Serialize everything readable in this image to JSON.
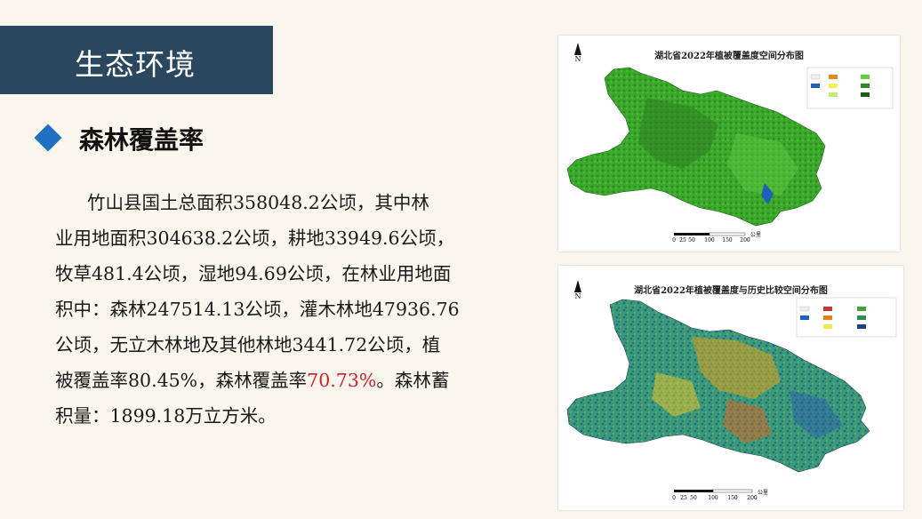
{
  "header": {
    "title": "生态环境"
  },
  "section": {
    "title": "森林覆盖率"
  },
  "paragraph": {
    "line1": "竹山县国土总面积358048.2公顷，其中林",
    "line2": "业用地面积304638.2公顷，耕地33949.6公顷，",
    "line3": "牧草481.4公顷，湿地94.69公顷，在林业用地面",
    "line4": "积中：森林247514.13公顷，灌木林地47936.76",
    "line5": "公顷，无立木林地及其他林地3441.72公顷，植",
    "line6_before": "被覆盖率80.45%，森林覆盖率",
    "line6_highlight": "70.73%",
    "line6_after": "。森林蓄",
    "line7": "积量：1899.18万立方米。"
  },
  "maps": [
    {
      "title": "湖北省2022年植被覆盖度空间分布图",
      "north": "N",
      "scale_labels": [
        "0",
        "25",
        "50",
        "100",
        "150",
        "200"
      ],
      "scale_unit": "公里"
    },
    {
      "title": "湖北省2022年植被覆盖度与历史比较空间分布图",
      "north": "N",
      "scale_labels": [
        "0",
        "25",
        "50",
        "100",
        "150",
        "200"
      ],
      "scale_unit": "公里"
    }
  ],
  "colors": {
    "banner": "#29485f",
    "diamond": "#1f6fc2",
    "highlight": "#d0202a"
  }
}
